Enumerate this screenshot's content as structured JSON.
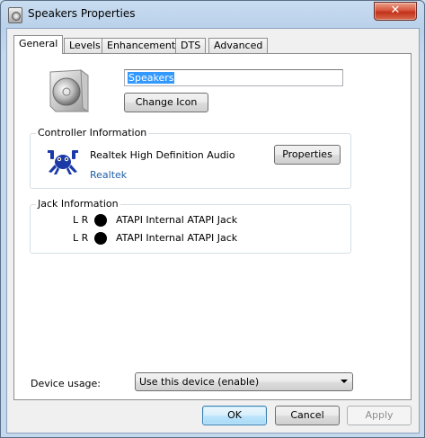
{
  "window": {
    "title": "Speakers Properties",
    "close_label": "✕"
  },
  "tabs": [
    {
      "label": "General"
    },
    {
      "label": "Levels"
    },
    {
      "label": "Enhancements"
    },
    {
      "label": "DTS"
    },
    {
      "label": "Advanced"
    }
  ],
  "device": {
    "name": "Speakers",
    "change_icon_label": "Change Icon"
  },
  "controller": {
    "group_title": "Controller Information",
    "name": "Realtek High Definition Audio",
    "vendor_link": "Realtek",
    "properties_label": "Properties"
  },
  "jack": {
    "group_title": "Jack Information",
    "rows": [
      {
        "channels": "L R",
        "name": "ATAPI Internal ATAPI Jack",
        "color": "#000000"
      },
      {
        "channels": "L R",
        "name": "ATAPI Internal ATAPI Jack",
        "color": "#000000"
      }
    ]
  },
  "usage": {
    "label": "Device usage:",
    "value": "Use this device (enable)"
  },
  "buttons": {
    "ok": "OK",
    "cancel": "Cancel",
    "apply": "Apply"
  },
  "icons": {
    "title": "speaker-icon",
    "device": "speaker-icon",
    "vendor": "realtek-crab-logo",
    "close": "close-icon",
    "dropdown": "chevron-down-icon"
  }
}
